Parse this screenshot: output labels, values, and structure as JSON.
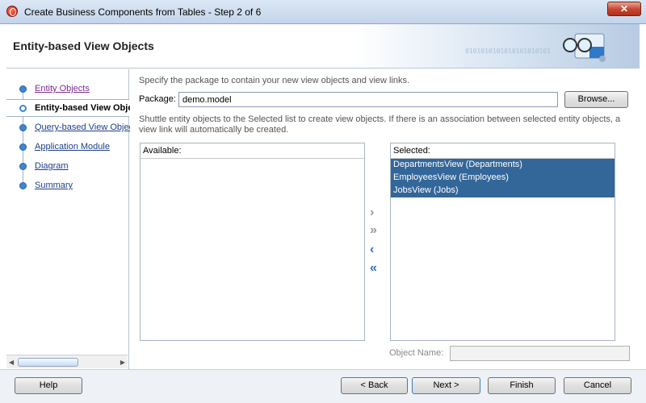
{
  "window": {
    "title": "Create Business Components from Tables - Step 2 of 6",
    "close_label": "✕"
  },
  "header": {
    "title": "Entity-based View Objects",
    "binary_text": "0101010101010101010101",
    "icon": "glasses-icon"
  },
  "nav": {
    "items": [
      {
        "label": "Entity Objects",
        "state": "visited"
      },
      {
        "label": "Entity-based View Objects",
        "state": "active"
      },
      {
        "label": "Query-based View Objects",
        "state": "link"
      },
      {
        "label": "Application Module",
        "state": "link"
      },
      {
        "label": "Diagram",
        "state": "link"
      },
      {
        "label": "Summary",
        "state": "link"
      }
    ]
  },
  "main": {
    "package_desc": "Specify the package to contain your new view objects and view links.",
    "package_label": "Package:",
    "package_value": "demo.model",
    "browse_label": "Browse...",
    "shuttle_desc_1": "Shuttle entity objects to the Selected list to create view objects.  If there is an association between selected entity objects, a",
    "shuttle_desc_2": "view link will automatically be created.",
    "available_label": "Available:",
    "selected_label": "Selected:",
    "selected_items": [
      "DepartmentsView (Departments)",
      "EmployeesView (Employees)",
      "JobsView (Jobs)"
    ],
    "object_name_label": "Object Name:",
    "object_name_value": ""
  },
  "footer": {
    "help": "Help",
    "back": "< Back",
    "next": "Next >",
    "finish": "Finish",
    "cancel": "Cancel"
  },
  "colors": {
    "selection": "#336699",
    "link": "#1e3f8a",
    "visited_link": "#7a2b91",
    "nav_dot": "#3d87d4"
  }
}
